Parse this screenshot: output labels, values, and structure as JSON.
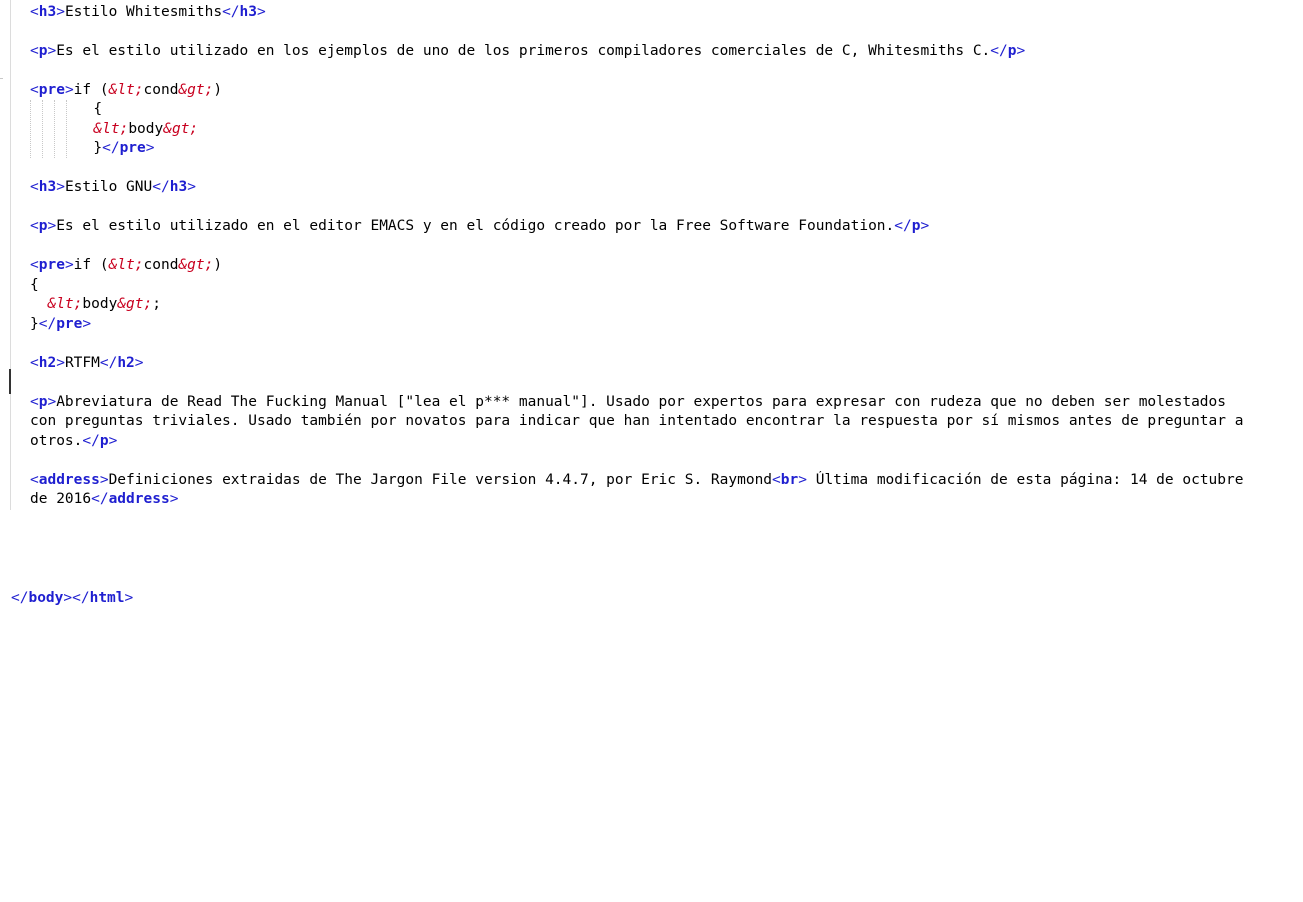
{
  "lines": [
    {
      "parts": [
        [
          "tag",
          "<"
        ],
        [
          "tname",
          "h3"
        ],
        [
          "tag",
          ">"
        ],
        [
          "txt",
          "Estilo Whitesmiths"
        ],
        [
          "tag",
          "</"
        ],
        [
          "tname",
          "h3"
        ],
        [
          "tag",
          ">"
        ]
      ]
    },
    {
      "parts": [
        [
          "tag",
          "<"
        ],
        [
          "tname",
          "p"
        ],
        [
          "tag",
          ">"
        ],
        [
          "txt",
          "Es el estilo utilizado en los ejemplos de uno de los primeros compiladores comerciales de C, Whitesmiths C."
        ],
        [
          "tag",
          "</"
        ],
        [
          "tname",
          "p"
        ],
        [
          "tag",
          ">"
        ]
      ]
    },
    {
      "parts": [
        [
          "tag",
          "<"
        ],
        [
          "tname",
          "pre"
        ],
        [
          "tag",
          ">"
        ],
        [
          "txt",
          "if ("
        ],
        [
          "ent",
          "&lt;"
        ],
        [
          "txt",
          "cond"
        ],
        [
          "ent",
          "&gt;"
        ],
        [
          "txt",
          ")"
        ]
      ]
    },
    {
      "parts": [
        [
          "txt",
          "      {"
        ]
      ]
    },
    {
      "parts": [
        [
          "txt",
          "      "
        ],
        [
          "ent",
          "&lt;"
        ],
        [
          "txt",
          "body"
        ],
        [
          "ent",
          "&gt;"
        ]
      ]
    },
    {
      "parts": [
        [
          "txt",
          "      }"
        ],
        [
          "tag",
          "</"
        ],
        [
          "tname",
          "pre"
        ],
        [
          "tag",
          ">"
        ]
      ]
    },
    {
      "parts": [
        [
          "tag",
          "<"
        ],
        [
          "tname",
          "h3"
        ],
        [
          "tag",
          ">"
        ],
        [
          "txt",
          "Estilo GNU"
        ],
        [
          "tag",
          "</"
        ],
        [
          "tname",
          "h3"
        ],
        [
          "tag",
          ">"
        ]
      ]
    },
    {
      "parts": [
        [
          "tag",
          "<"
        ],
        [
          "tname",
          "p"
        ],
        [
          "tag",
          ">"
        ],
        [
          "txt",
          "Es el estilo utilizado en el editor EMACS y en el código creado por la Free Software Foundation."
        ],
        [
          "tag",
          "</"
        ],
        [
          "tname",
          "p"
        ],
        [
          "tag",
          ">"
        ]
      ]
    },
    {
      "parts": [
        [
          "tag",
          "<"
        ],
        [
          "tname",
          "pre"
        ],
        [
          "tag",
          ">"
        ],
        [
          "txt",
          "if ("
        ],
        [
          "ent",
          "&lt;"
        ],
        [
          "txt",
          "cond"
        ],
        [
          "ent",
          "&gt;"
        ],
        [
          "txt",
          ")"
        ]
      ]
    },
    {
      "parts": [
        [
          "txt",
          "{"
        ]
      ]
    },
    {
      "parts": [
        [
          "txt",
          "  "
        ],
        [
          "ent",
          "&lt;"
        ],
        [
          "txt",
          "body"
        ],
        [
          "ent",
          "&gt;"
        ],
        [
          "txt",
          ";"
        ]
      ]
    },
    {
      "parts": [
        [
          "txt",
          "}"
        ],
        [
          "tag",
          "</"
        ],
        [
          "tname",
          "pre"
        ],
        [
          "tag",
          ">"
        ]
      ]
    },
    {
      "parts": [
        [
          "tag",
          "<"
        ],
        [
          "tname",
          "h2"
        ],
        [
          "tag",
          ">"
        ],
        [
          "txt",
          "RTFM"
        ],
        [
          "tag",
          "</"
        ],
        [
          "tname",
          "h2"
        ],
        [
          "tag",
          ">"
        ]
      ]
    },
    {
      "parts": [
        [
          "tag",
          "<"
        ],
        [
          "tname",
          "p"
        ],
        [
          "tag",
          ">"
        ],
        [
          "txt",
          "Abreviatura de Read The Fucking Manual [\"lea el p*** manual\"]. Usado por expertos para expresar con rudeza que no deben ser molestados"
        ]
      ]
    },
    {
      "parts": [
        [
          "txt",
          "con preguntas triviales. Usado también por novatos para indicar que han intentado encontrar la respuesta por sí mismos antes de preguntar a"
        ]
      ]
    },
    {
      "parts": [
        [
          "txt",
          "otros."
        ],
        [
          "tag",
          "</"
        ],
        [
          "tname",
          "p"
        ],
        [
          "tag",
          ">"
        ]
      ]
    },
    {
      "parts": [
        [
          "tag",
          "<"
        ],
        [
          "tname",
          "address"
        ],
        [
          "tag",
          ">"
        ],
        [
          "txt",
          "Definiciones extraidas de The Jargon File version 4.4.7, por Eric S. Raymond"
        ],
        [
          "tag",
          "<"
        ],
        [
          "tname",
          "br"
        ],
        [
          "tag",
          ">"
        ],
        [
          "txt",
          " Última modificación de esta página: 14 de octubre"
        ]
      ]
    },
    {
      "parts": [
        [
          "txt",
          "de 2016"
        ],
        [
          "tag",
          "</"
        ],
        [
          "tname",
          "address"
        ],
        [
          "tag",
          ">"
        ]
      ]
    },
    {
      "parts": [
        [
          "tag",
          "</"
        ],
        [
          "tname",
          "body"
        ],
        [
          "tag",
          "></"
        ],
        [
          "tname",
          "html"
        ],
        [
          "tag",
          ">"
        ]
      ]
    }
  ]
}
